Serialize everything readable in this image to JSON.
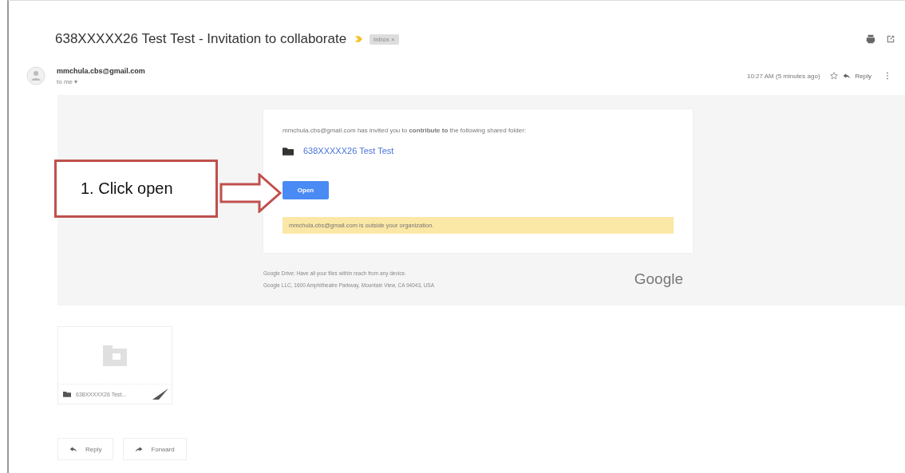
{
  "email": {
    "subject": "638XXXXX26 Test Test - Invitation to collaborate",
    "label": "Inbox ×",
    "sender": "mmchula.cbs@gmail.com",
    "recipient": "to me ▾",
    "time": "10:27 AM (5 minutes ago)",
    "reply": "Reply"
  },
  "invite": {
    "message": "mmchula.cbs@gmail.com has invited you to **contribute to** the following shared folder:",
    "folder": "638XXXXX26 Test Test",
    "button": "Open",
    "notice": "mmchula.cbs@gmail.com is outside your organization."
  },
  "footer": {
    "lines": [
      "Google Drive: Have all your files within reach from any device.",
      "Google LLC, 1600 Amphitheatre Parkway, Mountain View, CA 94043, USA"
    ],
    "logo": "Google"
  },
  "attachment": {
    "name": "638XXXXX26 Test..."
  },
  "actions": [
    {
      "kind": "reply",
      "label": "Reply"
    },
    {
      "kind": "forward",
      "label": "Forward"
    }
  ],
  "callout": {
    "text": "1. Click open"
  }
}
